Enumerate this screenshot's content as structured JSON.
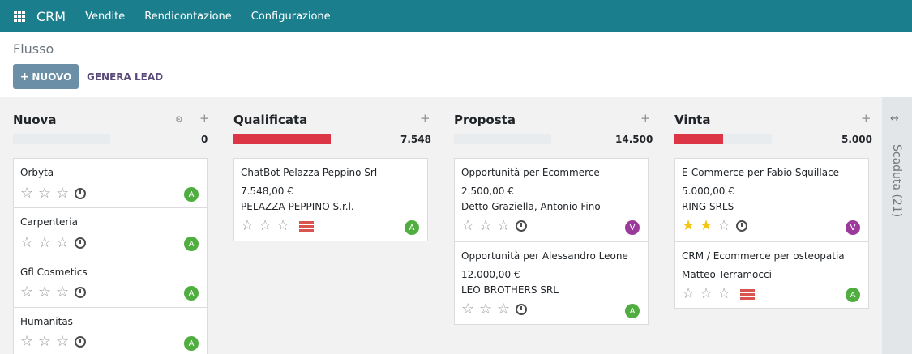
{
  "topbar": {
    "icon": "apps-grid-icon",
    "brand": "CRM",
    "menu": [
      "Vendite",
      "Rendicontazione",
      "Configurazione"
    ]
  },
  "controlpanel": {
    "breadcrumb": "Flusso",
    "new_button": "NUOVO",
    "generate_button": "GENERA LEAD"
  },
  "columns": [
    {
      "title": "Nuova",
      "total": "0",
      "progress": 0,
      "cards": [
        {
          "title": "Orbyta",
          "stars": 0,
          "avatar": "A"
        },
        {
          "title": "Carpenteria",
          "stars": 0,
          "avatar": "A"
        },
        {
          "title": "Gfl Cosmetics",
          "stars": 0,
          "avatar": "A"
        },
        {
          "title": "Humanitas",
          "stars": 0,
          "avatar": "A"
        }
      ]
    },
    {
      "title": "Qualificata",
      "total": "7.548",
      "progress": 1.0,
      "cards": [
        {
          "title": "ChatBot Pelazza Peppino Srl",
          "amount": "7.548,00 €",
          "partner": "PELAZZA PEPPINO S.r.l.",
          "stars": 0,
          "avatar": "A"
        }
      ]
    },
    {
      "title": "Proposta",
      "total": "14.500",
      "progress": 0,
      "cards": [
        {
          "title": "Opportunità per Ecommerce",
          "amount": "2.500,00 €",
          "partner": "Detto Graziella, Antonio Fino",
          "stars": 0,
          "avatar": "V"
        },
        {
          "title": "Opportunità per Alessandro Leone",
          "amount": "12.000,00 €",
          "partner": "LEO BROTHERS SRL",
          "stars": 0,
          "avatar": "A"
        }
      ]
    },
    {
      "title": "Vinta",
      "total": "5.000",
      "progress": 0.5,
      "cards": [
        {
          "title": "E-Commerce per Fabio Squillace",
          "amount": "5.000,00 €",
          "partner": "RING SRLS",
          "stars": 2,
          "avatar": "V"
        },
        {
          "title": "CRM / Ecommerce per osteopatia",
          "partner": "Matteo Terramocci",
          "stars": 0,
          "avatar": "A"
        }
      ]
    }
  ],
  "folded_column": {
    "label": "Scaduta (21)"
  },
  "colors": {
    "topbar": "#1b7e8c",
    "primary_button": "#6a8fa6",
    "progress_fill": "#dc3545",
    "avatar_a": "#4fae3f",
    "avatar_v": "#9b3a9b",
    "star_on": "#f3c614"
  }
}
